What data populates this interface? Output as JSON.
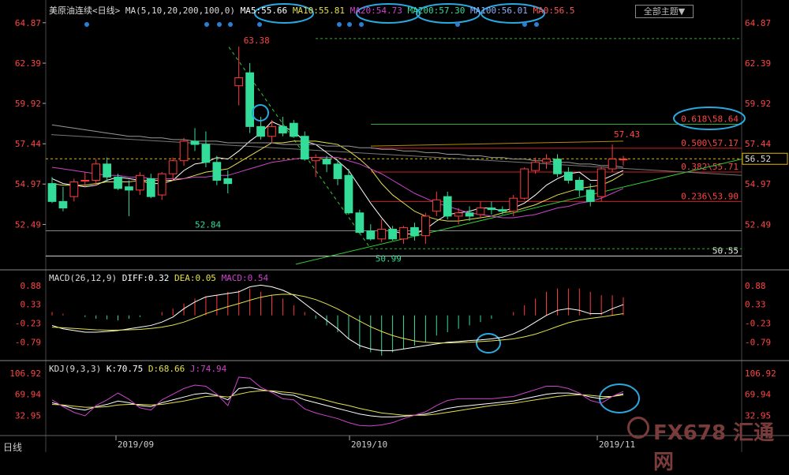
{
  "header": {
    "title": "美原油连续<日线>",
    "ma_label": "MA(5,10,20,200,100,0)",
    "ma5": "MA5:55.66",
    "ma10": "MA10:55.81",
    "ma20": "MA20:54.73",
    "ma200": "MA200:57.30",
    "ma100": "MA100:56.01",
    "ma0": "MA0:56.5",
    "theme_button": "全部主题▼"
  },
  "macd_header": {
    "label": "MACD(26,12,9)",
    "diff": "DIFF:0.32",
    "dea": "DEA:0.05",
    "macd": "MACD:0.54"
  },
  "kdj_header": {
    "label": "KDJ(9,3,3)",
    "k": "K:70.75",
    "d": "D:68.66",
    "j": "J:74.94"
  },
  "footer": {
    "period": "日线"
  },
  "watermark": "FX678 汇通网",
  "colors": {
    "up": "#ff3b3b",
    "down": "#33dd99",
    "ma5": "#ffffff",
    "ma10": "#e6e04a",
    "ma20": "#cc44cc",
    "ma200": "#999999",
    "highlight": "#2aa8e0"
  },
  "chart_data": {
    "type": "candlestick",
    "y_ticks": [
      "64.87",
      "62.39",
      "59.92",
      "57.44",
      "54.97",
      "52.49"
    ],
    "price_tag": "56.52",
    "high_annotation": "63.38",
    "low_annotation_1": "52.84",
    "low_annotation_2": "50.99",
    "recent_high_annotation": "57.43",
    "right_level": "50.55",
    "fib_levels": [
      {
        "label": "0.618\\58.64",
        "value": 58.64
      },
      {
        "label": "0.500\\57.17",
        "value": 57.17
      },
      {
        "label": "0.382\\55.71",
        "value": 55.71
      },
      {
        "label": "0.236\\53.90",
        "value": 53.9
      }
    ],
    "x_labels": [
      "2019/09",
      "2019/10",
      "2019/11"
    ],
    "macd_ticks": [
      "0.88",
      "0.33",
      "-0.23",
      "-0.79"
    ],
    "kdj_ticks": [
      "106.92",
      "69.94",
      "32.95"
    ],
    "candles": [
      [
        55.0,
        55.4,
        53.8,
        53.9
      ],
      [
        53.9,
        54.8,
        53.3,
        53.5
      ],
      [
        54.2,
        55.3,
        53.9,
        55.1
      ],
      [
        55.2,
        55.7,
        54.8,
        55.2
      ],
      [
        55.2,
        56.5,
        54.9,
        56.2
      ],
      [
        56.2,
        56.6,
        55.1,
        55.4
      ],
      [
        55.4,
        55.6,
        54.6,
        54.7
      ],
      [
        54.8,
        55.2,
        53.0,
        54.6
      ],
      [
        54.6,
        55.7,
        54.3,
        55.5
      ],
      [
        55.3,
        55.6,
        54.1,
        54.2
      ],
      [
        54.3,
        55.7,
        54.0,
        55.6
      ],
      [
        55.6,
        56.6,
        55.2,
        56.4
      ],
      [
        56.4,
        57.8,
        56.1,
        57.6
      ],
      [
        57.6,
        58.4,
        57.0,
        57.4
      ],
      [
        57.4,
        58.2,
        56.0,
        56.3
      ],
      [
        56.3,
        56.7,
        54.9,
        55.2
      ],
      [
        55.3,
        55.8,
        54.4,
        55.0
      ],
      [
        61.0,
        63.4,
        59.8,
        61.5
      ],
      [
        61.8,
        62.4,
        58.1,
        58.5
      ],
      [
        58.5,
        59.1,
        57.7,
        57.9
      ],
      [
        57.9,
        58.9,
        57.5,
        58.5
      ],
      [
        58.5,
        59.1,
        57.9,
        58.1
      ],
      [
        58.7,
        58.9,
        57.8,
        57.9
      ],
      [
        57.9,
        58.2,
        56.4,
        56.5
      ],
      [
        56.4,
        56.8,
        55.4,
        56.6
      ],
      [
        56.5,
        56.7,
        55.7,
        56.2
      ],
      [
        56.2,
        56.5,
        54.9,
        55.3
      ],
      [
        55.5,
        55.9,
        53.1,
        53.2
      ],
      [
        53.2,
        53.4,
        51.9,
        52.0
      ],
      [
        52.1,
        52.5,
        51.5,
        51.6
      ],
      [
        51.6,
        52.8,
        51.4,
        52.2
      ],
      [
        52.2,
        52.4,
        51.5,
        51.6
      ],
      [
        51.6,
        52.4,
        51.3,
        52.3
      ],
      [
        52.3,
        52.6,
        51.5,
        51.8
      ],
      [
        51.8,
        53.2,
        51.3,
        53.0
      ],
      [
        53.3,
        54.5,
        53.0,
        54.0
      ],
      [
        54.2,
        54.5,
        52.8,
        53.0
      ],
      [
        53.0,
        53.5,
        52.5,
        53.2
      ],
      [
        53.2,
        53.6,
        52.7,
        53.0
      ],
      [
        53.1,
        53.9,
        52.9,
        53.5
      ],
      [
        53.5,
        53.9,
        53.1,
        53.4
      ],
      [
        53.4,
        53.6,
        53.1,
        53.3
      ],
      [
        53.3,
        54.3,
        53.0,
        54.1
      ],
      [
        54.1,
        56.0,
        54.0,
        55.9
      ],
      [
        55.8,
        56.6,
        55.6,
        56.3
      ],
      [
        56.3,
        56.8,
        55.9,
        56.5
      ],
      [
        56.5,
        56.8,
        55.4,
        55.6
      ],
      [
        55.7,
        56.0,
        55.0,
        55.2
      ],
      [
        55.2,
        55.4,
        54.2,
        54.6
      ],
      [
        54.6,
        55.0,
        53.6,
        53.9
      ],
      [
        54.2,
        56.0,
        53.9,
        55.9
      ],
      [
        55.9,
        57.4,
        55.7,
        56.5
      ],
      [
        56.5,
        56.7,
        56.1,
        56.5
      ]
    ],
    "ma_series": {
      "ma5": [
        55.3,
        55.0,
        54.9,
        54.8,
        54.9,
        55.2,
        55.4,
        55.3,
        55.2,
        55.0,
        55.0,
        55.2,
        55.8,
        56.2,
        56.3,
        56.6,
        56.5,
        57.0,
        57.6,
        58.1,
        58.8,
        58.5,
        58.2,
        57.6,
        57.4,
        56.9,
        56.4,
        55.8,
        54.8,
        53.8,
        52.9,
        52.1,
        51.9,
        51.9,
        52.2,
        52.7,
        53.1,
        53.2,
        53.3,
        53.5,
        53.5,
        53.3,
        53.5,
        53.8,
        54.3,
        54.9,
        55.3,
        55.6,
        55.7,
        55.2,
        55.2,
        55.5,
        55.8
      ],
      "ma10": [
        55.0,
        54.9,
        54.9,
        54.9,
        55.0,
        55.1,
        55.1,
        55.1,
        55.2,
        55.2,
        55.2,
        55.2,
        55.3,
        55.5,
        55.7,
        55.8,
        55.9,
        56.3,
        56.7,
        57.1,
        57.5,
        57.5,
        57.6,
        57.6,
        57.6,
        57.5,
        57.4,
        57.0,
        56.5,
        55.9,
        55.0,
        54.3,
        53.8,
        53.3,
        53.0,
        52.8,
        52.7,
        52.7,
        52.8,
        52.9,
        53.0,
        53.2,
        53.3,
        53.5,
        53.7,
        54.0,
        54.3,
        54.5,
        54.7,
        54.8,
        54.9,
        55.2,
        55.6
      ],
      "ma20": [
        56.0,
        55.9,
        55.8,
        55.7,
        55.6,
        55.5,
        55.5,
        55.4,
        55.4,
        55.3,
        55.3,
        55.3,
        55.3,
        55.4,
        55.4,
        55.5,
        55.5,
        55.7,
        55.9,
        56.1,
        56.3,
        56.4,
        56.5,
        56.6,
        56.6,
        56.6,
        56.6,
        56.4,
        56.2,
        55.9,
        55.6,
        55.2,
        54.8,
        54.4,
        54.1,
        53.8,
        53.6,
        53.4,
        53.2,
        53.1,
        53.0,
        52.9,
        52.9,
        53.0,
        53.1,
        53.3,
        53.5,
        53.6,
        53.8,
        53.9,
        54.1,
        54.4,
        54.7
      ],
      "ma200": [
        58.6,
        58.5,
        58.4,
        58.3,
        58.2,
        58.1,
        58.0,
        57.9,
        57.9,
        57.8,
        57.8,
        57.7,
        57.7,
        57.6,
        57.6,
        57.6,
        57.5,
        57.5,
        57.5,
        57.5,
        57.5,
        57.4,
        57.4,
        57.4,
        57.4,
        57.3,
        57.3,
        57.3,
        57.2,
        57.2,
        57.1,
        57.1,
        57.0,
        57.0,
        56.9,
        56.9,
        56.8,
        56.8,
        56.7,
        56.7,
        56.6,
        56.6,
        56.5,
        56.5,
        56.4,
        56.4,
        56.3,
        56.3,
        56.2,
        56.2,
        56.1,
        56.1,
        56.0
      ]
    },
    "macd": {
      "hist": [
        0.1,
        0.05,
        0.0,
        -0.05,
        -0.1,
        -0.12,
        -0.15,
        -0.1,
        -0.05,
        0.0,
        0.1,
        0.2,
        0.35,
        0.5,
        0.55,
        0.6,
        0.7,
        0.75,
        0.8,
        0.7,
        0.6,
        0.5,
        0.3,
        0.1,
        -0.1,
        -0.3,
        -0.5,
        -0.7,
        -1.0,
        -1.1,
        -1.2,
        -1.1,
        -1.0,
        -0.9,
        -0.8,
        -0.6,
        -0.5,
        -0.4,
        -0.3,
        -0.2,
        -0.1,
        0.0,
        0.1,
        0.3,
        0.5,
        0.7,
        0.8,
        0.8,
        0.8,
        0.7,
        0.6,
        0.6,
        0.54
      ],
      "diff": [
        -0.3,
        -0.4,
        -0.45,
        -0.5,
        -0.5,
        -0.48,
        -0.45,
        -0.4,
        -0.35,
        -0.3,
        -0.2,
        -0.05,
        0.2,
        0.4,
        0.55,
        0.6,
        0.65,
        0.7,
        0.85,
        0.9,
        0.85,
        0.75,
        0.6,
        0.35,
        0.1,
        -0.15,
        -0.4,
        -0.7,
        -0.9,
        -1.0,
        -1.05,
        -1.05,
        -1.0,
        -0.95,
        -0.9,
        -0.85,
        -0.8,
        -0.78,
        -0.75,
        -0.73,
        -0.7,
        -0.65,
        -0.55,
        -0.4,
        -0.2,
        0.0,
        0.15,
        0.2,
        0.15,
        0.05,
        0.05,
        0.2,
        0.32
      ],
      "dea": [
        -0.35,
        -0.37,
        -0.39,
        -0.41,
        -0.43,
        -0.44,
        -0.44,
        -0.43,
        -0.42,
        -0.39,
        -0.35,
        -0.29,
        -0.2,
        -0.08,
        0.05,
        0.16,
        0.26,
        0.35,
        0.45,
        0.54,
        0.6,
        0.63,
        0.62,
        0.56,
        0.47,
        0.34,
        0.19,
        0.01,
        -0.17,
        -0.34,
        -0.48,
        -0.6,
        -0.69,
        -0.76,
        -0.8,
        -0.82,
        -0.82,
        -0.81,
        -0.8,
        -0.78,
        -0.76,
        -0.73,
        -0.7,
        -0.64,
        -0.56,
        -0.45,
        -0.33,
        -0.22,
        -0.14,
        -0.09,
        -0.05,
        0.0,
        0.05
      ]
    },
    "kdj": {
      "k": [
        55,
        50,
        45,
        42,
        48,
        52,
        58,
        55,
        50,
        48,
        55,
        60,
        65,
        70,
        72,
        68,
        60,
        80,
        82,
        78,
        75,
        70,
        68,
        60,
        55,
        50,
        45,
        40,
        35,
        32,
        30,
        30,
        31,
        33,
        35,
        40,
        45,
        48,
        50,
        52,
        54,
        56,
        58,
        62,
        66,
        70,
        72,
        72,
        70,
        65,
        62,
        66,
        70.75
      ],
      "d": [
        52,
        51,
        49,
        47,
        47,
        48,
        51,
        52,
        52,
        51,
        52,
        55,
        58,
        62,
        66,
        67,
        65,
        70,
        74,
        76,
        76,
        74,
        72,
        68,
        64,
        59,
        54,
        50,
        45,
        41,
        37,
        35,
        33,
        33,
        33,
        35,
        38,
        41,
        44,
        47,
        50,
        52,
        54,
        57,
        60,
        63,
        66,
        68,
        69,
        68,
        66,
        66,
        68.66
      ],
      "j": [
        60,
        48,
        38,
        32,
        50,
        60,
        72,
        61,
        46,
        42,
        60,
        70,
        80,
        86,
        84,
        70,
        50,
        100,
        98,
        82,
        73,
        62,
        60,
        44,
        37,
        32,
        27,
        20,
        15,
        14,
        16,
        20,
        27,
        33,
        39,
        50,
        59,
        62,
        62,
        62,
        62,
        64,
        66,
        72,
        78,
        84,
        84,
        80,
        72,
        59,
        54,
        66,
        74.94
      ]
    }
  }
}
